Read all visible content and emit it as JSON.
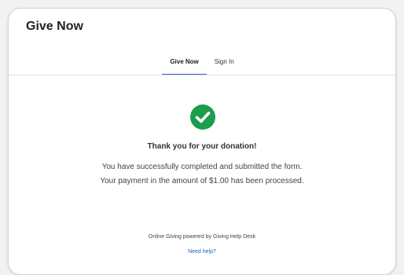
{
  "header": {
    "title": "Give Now"
  },
  "tabs": [
    {
      "label": "Give Now",
      "active": true
    },
    {
      "label": "Sign In",
      "active": false
    }
  ],
  "confirmation": {
    "icon": "check-circle-icon",
    "heading": "Thank you for your donation!",
    "line1": "You have successfully completed and submitted the form.",
    "line2": "Your payment in the amount of $1.00 has been processed."
  },
  "footer": {
    "powered_by": "Online Giving powered by Giving Help Desk",
    "help_link": "Need help?"
  },
  "colors": {
    "accent": "#2f63c4",
    "success": "#1a9e4b",
    "link": "#1f5fc7"
  }
}
